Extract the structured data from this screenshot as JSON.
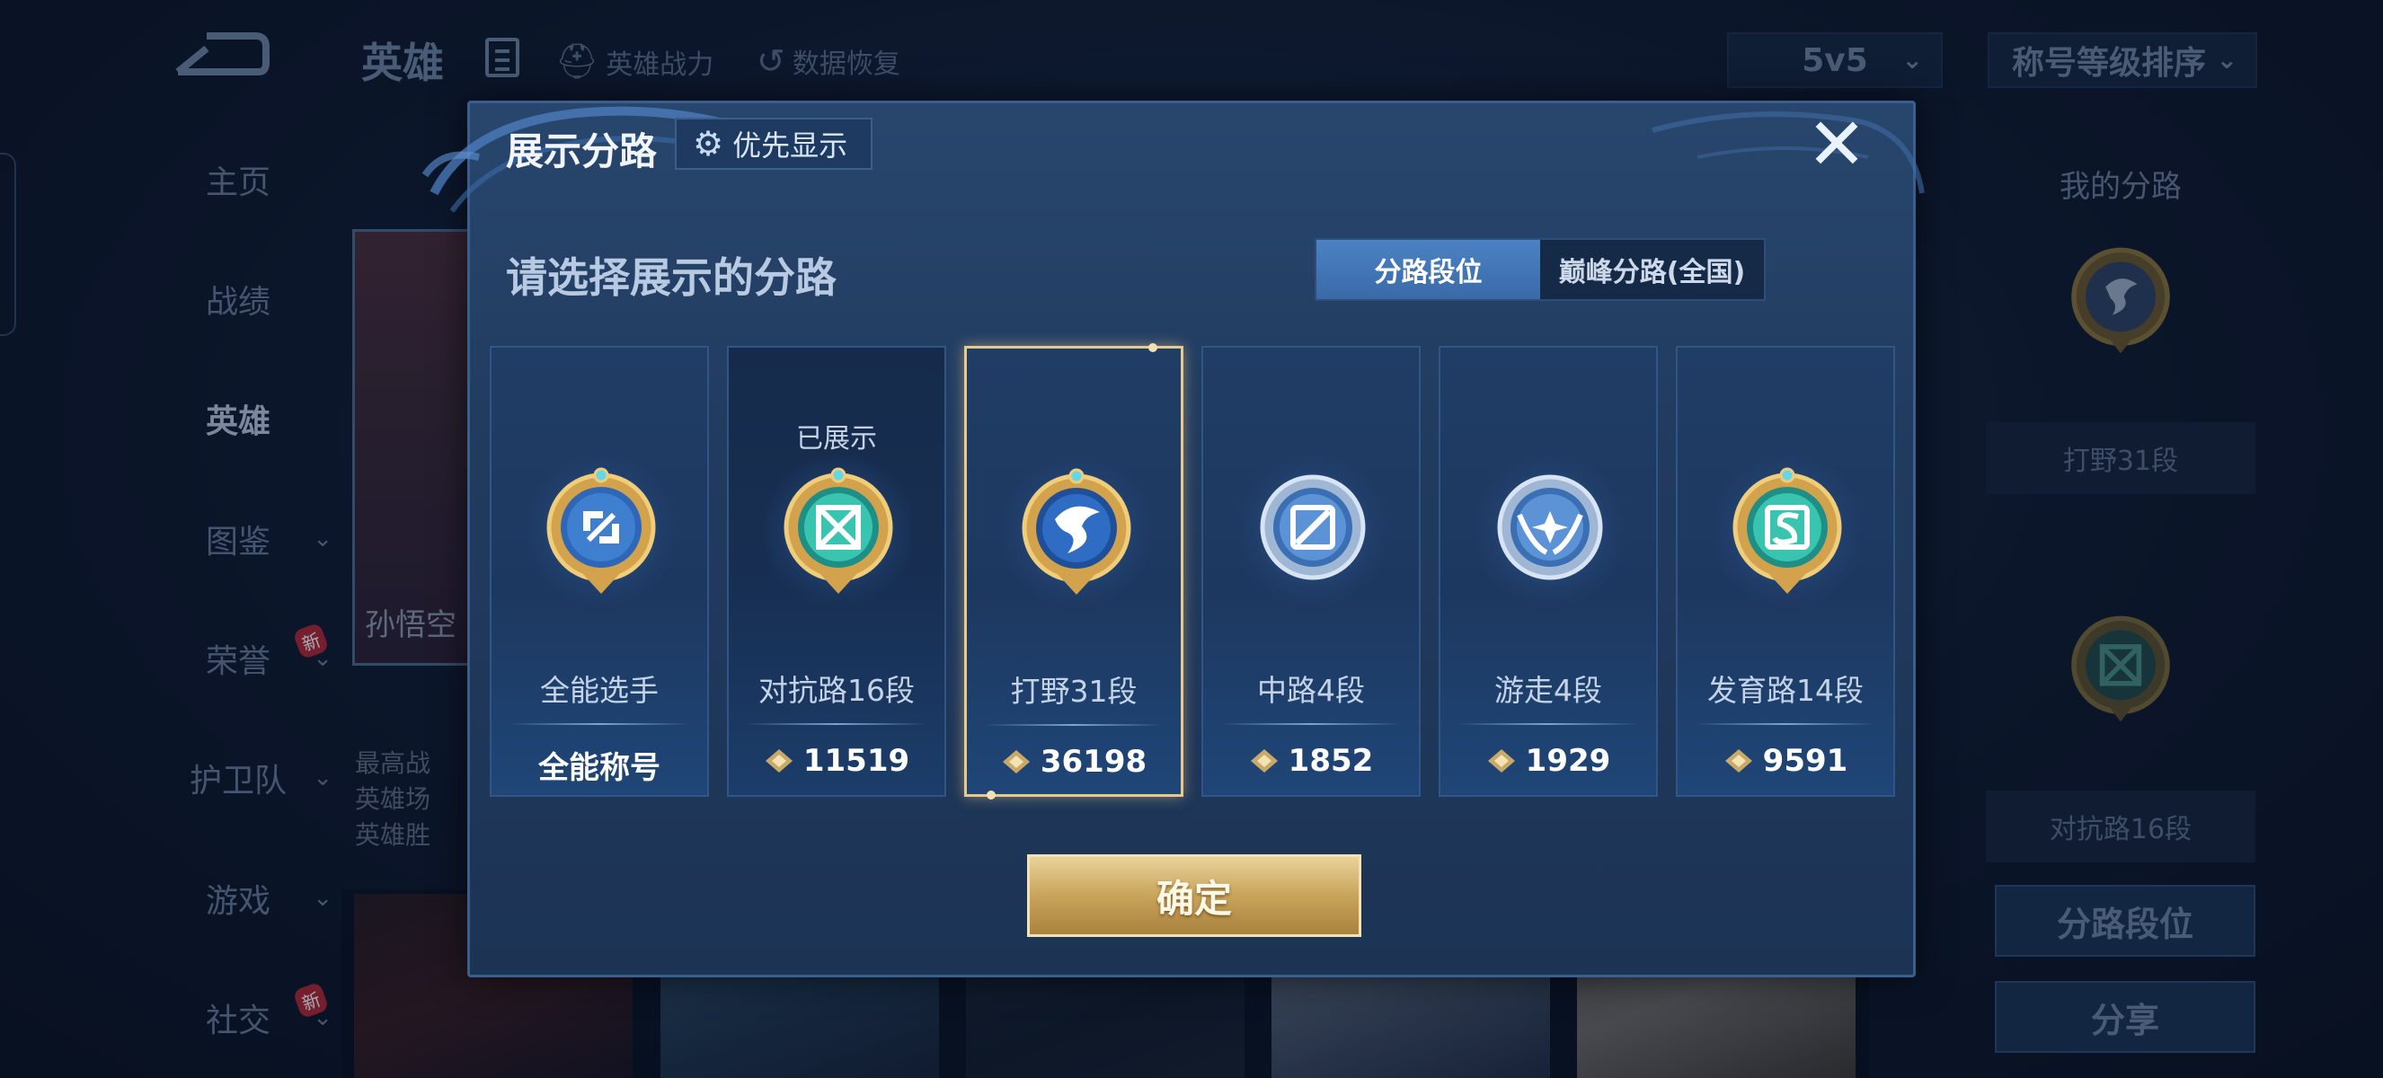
{
  "topbar": {
    "title": "英雄",
    "hero_power_label": "英雄战力",
    "data_restore_label": "数据恢复",
    "mode_select": "5v5",
    "sort_select": "称号等级排序"
  },
  "sidebar": {
    "items": [
      {
        "label": "主页",
        "arrow": false,
        "new": false
      },
      {
        "label": "战绩",
        "arrow": false,
        "new": false
      },
      {
        "label": "英雄",
        "arrow": false,
        "new": false
      },
      {
        "label": "图鉴",
        "arrow": true,
        "new": false
      },
      {
        "label": "荣誉",
        "arrow": true,
        "new": true
      },
      {
        "label": "护卫队",
        "arrow": true,
        "new": false
      },
      {
        "label": "游戏",
        "arrow": true,
        "new": false
      },
      {
        "label": "社交",
        "arrow": true,
        "new": true
      }
    ],
    "new_tag": "新"
  },
  "hero_card": {
    "name": "孙悟空",
    "info_lines": [
      "最高战",
      "英雄场",
      "英雄胜"
    ]
  },
  "right_panel": {
    "title": "我的分路",
    "label_1": "打野31段",
    "label_2": "对抗路16段",
    "button_1": "分路段位",
    "button_2": "分享"
  },
  "modal": {
    "title": "展示分路",
    "priority_label": "优先显示",
    "close_symbol": "✕",
    "subtitle": "请选择展示的分路",
    "tabs": [
      {
        "label": "分路段位",
        "active": true
      },
      {
        "label": "巅峰分路(全国)",
        "active": false
      }
    ],
    "cards": [
      {
        "name": "全能选手",
        "value": "全能称号",
        "show_gem": false,
        "shown_label": "",
        "emblem": "all-round-emblem",
        "selected": false
      },
      {
        "name": "对抗路16段",
        "value": "11519",
        "show_gem": true,
        "shown_label": "已展示",
        "emblem": "clash-lane-emblem",
        "selected": false
      },
      {
        "name": "打野31段",
        "value": "36198",
        "show_gem": true,
        "shown_label": "",
        "emblem": "jungle-emblem",
        "selected": true
      },
      {
        "name": "中路4段",
        "value": "1852",
        "show_gem": true,
        "shown_label": "",
        "emblem": "mid-lane-emblem",
        "selected": false
      },
      {
        "name": "游走4段",
        "value": "1929",
        "show_gem": true,
        "shown_label": "",
        "emblem": "roam-emblem",
        "selected": false
      },
      {
        "name": "发育路14段",
        "value": "9591",
        "show_gem": true,
        "shown_label": "",
        "emblem": "farm-lane-emblem",
        "selected": false
      }
    ],
    "confirm_label": "确定"
  },
  "colors": {
    "accent_gold": "#e9c98a",
    "tab_active": "#4b82c4",
    "modal_bg": "#213b5f"
  }
}
